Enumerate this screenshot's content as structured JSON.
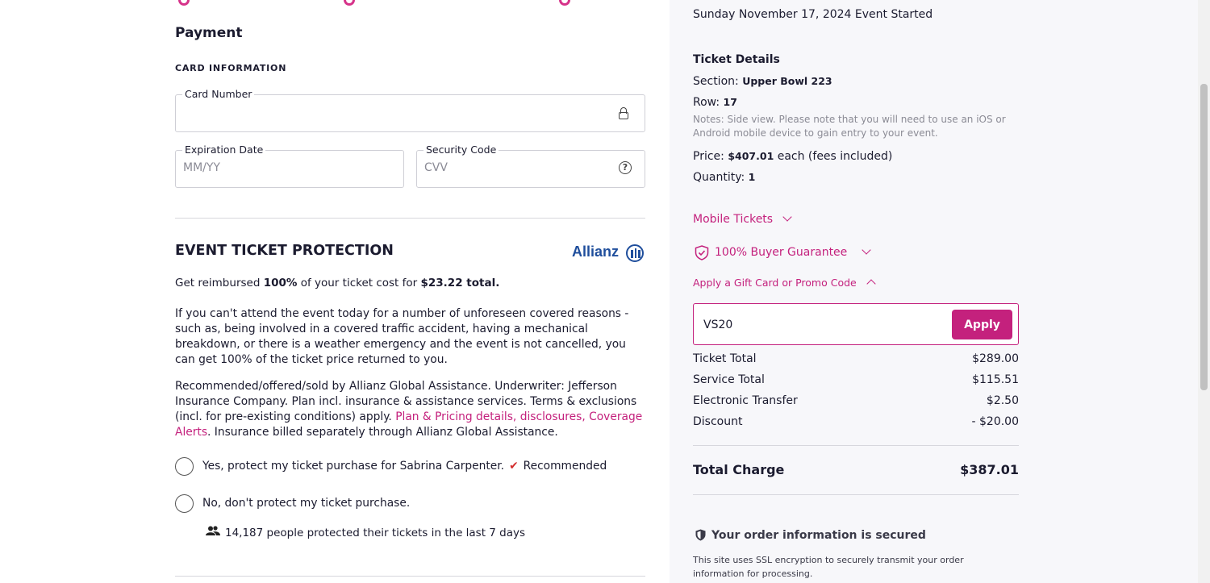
{
  "payment": {
    "title": "Payment",
    "card_section": "CARD INFORMATION",
    "card_number_label": "Card Number",
    "expiration_label": "Expiration Date",
    "expiration_placeholder": "MM/YY",
    "security_label": "Security Code",
    "security_placeholder": "CVV",
    "icons": {
      "card_number": "lock-icon",
      "security": "help-icon"
    }
  },
  "protection": {
    "title": "EVENT TICKET PROTECTION",
    "brand": "Allianz",
    "reimb_prefix": "Get reimbursed ",
    "reimb_pct": "100%",
    "reimb_mid": " of your ticket cost for ",
    "reimb_amount": "$23.22 total.",
    "body1": "If you can't attend the event today for a number of unforeseen covered reasons - such as, being involved in a covered traffic accident, having a mechanical breakdown, or there is a weather emergency and the event is not cancelled, you can get 100% of the ticket price returned to you.",
    "body2_prefix": "Recommended/offered/sold by Allianz Global Assistance. Underwriter: Jefferson Insurance Company. Plan incl. insurance & assistance services. Terms & exclusions (incl. for pre-existing conditions) apply. ",
    "link_pricing": "Plan & Pricing details,",
    "link_disclosures": "disclosures,",
    "link_alerts": "Coverage Alerts",
    "body2_suffix": ". Insurance billed separately through Allianz Global Assistance.",
    "option_yes": "Yes, protect my ticket purchase for Sabrina Carpenter.",
    "check_mark": "✔",
    "recommended": "Recommended",
    "option_no": "No, don't protect my ticket purchase.",
    "social_proof": "14,187 people protected their tickets in the last 7 days"
  },
  "order": {
    "event_date": "Sunday November 17, 2024 Event Started",
    "ticket_details_title": "Ticket Details",
    "section_label": "Section: ",
    "section_value": "Upper Bowl 223",
    "row_label": "Row: ",
    "row_value": "17",
    "notes": "Notes: Side view. Please note that you will need to use an iOS or Android mobile device to gain entry to your event.",
    "price_label": "Price: ",
    "price_value": "$407.01",
    "price_suffix": " each (fees included)",
    "quantity_label": "Quantity: ",
    "quantity_value": "1",
    "mobile_tickets": "Mobile Tickets",
    "buyer_guarantee": "100% Buyer Guarantee",
    "promo_toggle": "Apply a Gift Card or Promo Code",
    "promo_value": "VS20",
    "apply_label": "Apply",
    "summary": [
      {
        "label": "Ticket Total",
        "amount": "$289.00"
      },
      {
        "label": "Service Total",
        "amount": "$115.51"
      },
      {
        "label": "Electronic Transfer",
        "amount": "$2.50"
      },
      {
        "label": "Discount",
        "amount": "- $20.00"
      }
    ],
    "total_label": "Total Charge",
    "total_amount": "$387.01",
    "secure_title": "Your order information is secured",
    "secure_text": "This site uses SSL encryption to securely transmit your order information for processing."
  },
  "colors": {
    "accent": "#c4217d",
    "allianz_blue": "#1f4e9c",
    "check": "#d32f2f"
  }
}
